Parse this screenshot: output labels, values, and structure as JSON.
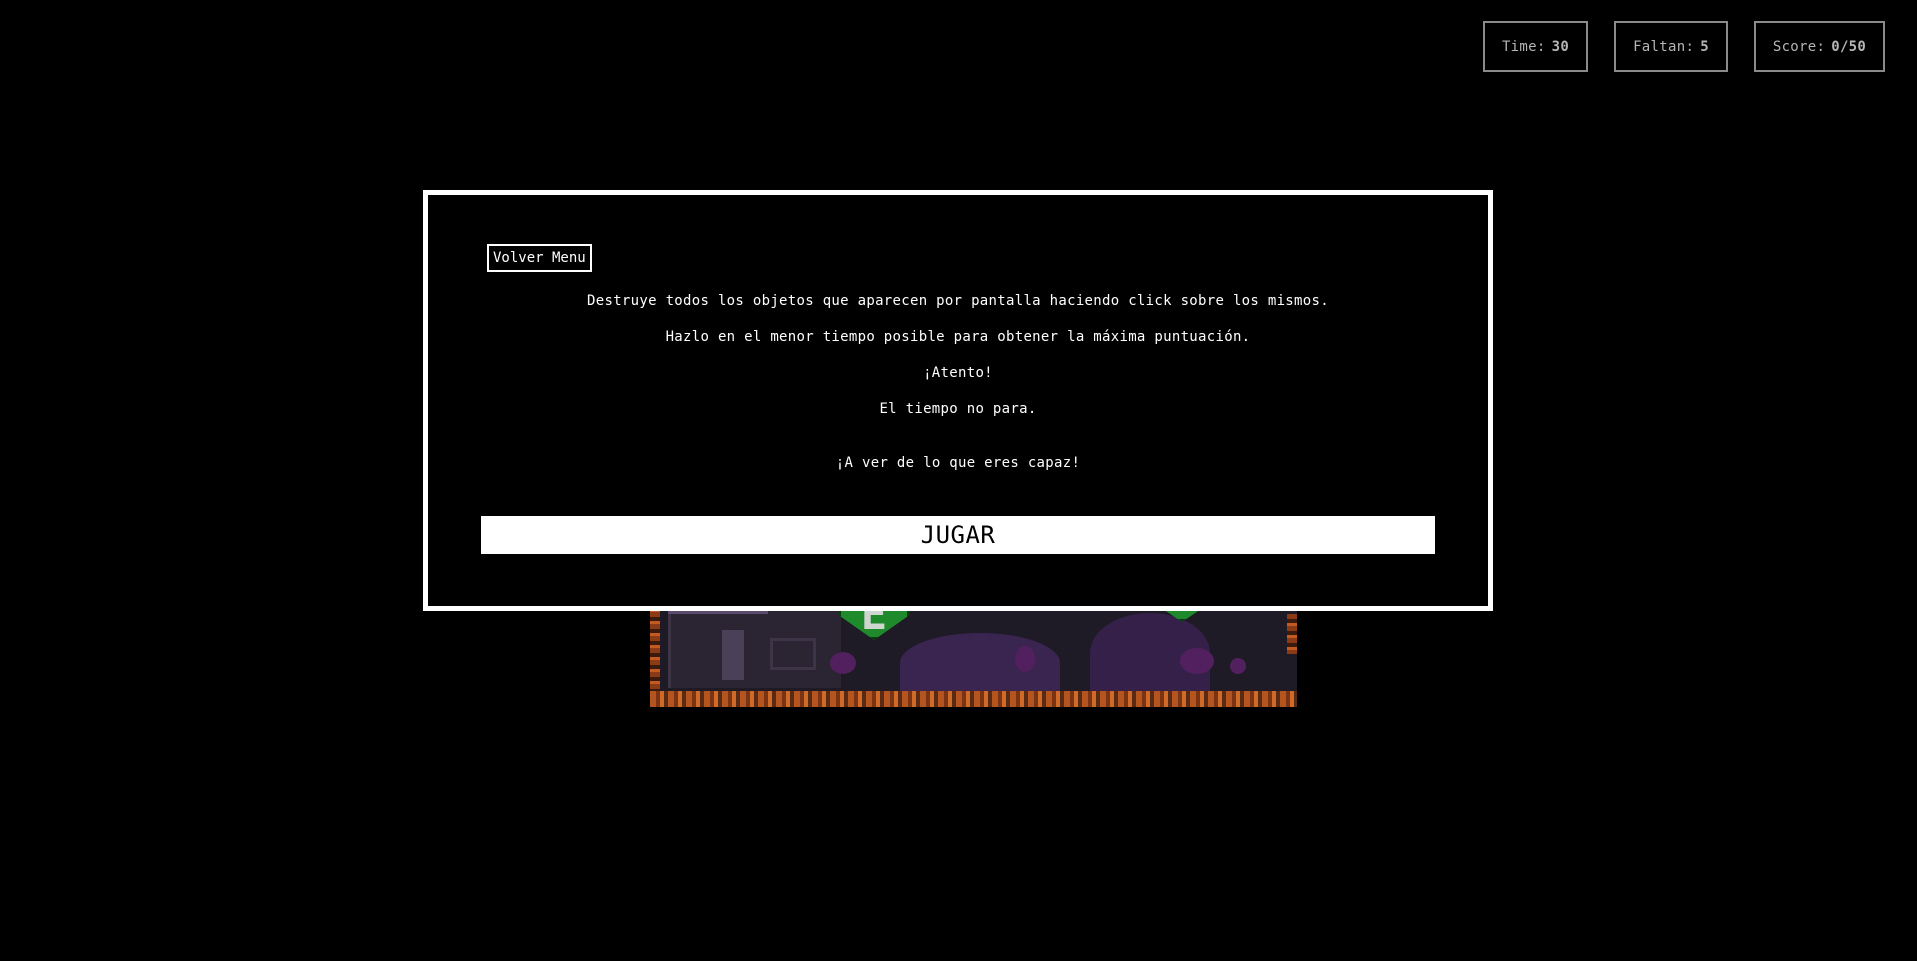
{
  "hud": {
    "time_label": "Time:",
    "time_value": "30",
    "remaining_label": "Faltan:",
    "remaining_value": "5",
    "score_label": "Score:",
    "score_value": "0/50"
  },
  "modal": {
    "back_label": "Volver Menu",
    "lines": [
      "Destruye todos los objetos que aparecen por pantalla haciendo click sobre los mismos.",
      "Hazlo en el menor tiempo posible para obtener la máxima puntuación.",
      "¡Atento!",
      "El tiempo no para.",
      "¡A ver de lo que eres capaz!"
    ],
    "play_label": "JUGAR"
  },
  "game": {
    "targets": [
      {
        "letter": "E",
        "color": "#1f8a2c"
      },
      {
        "letter": "",
        "color": "#1f8a2c"
      }
    ]
  }
}
